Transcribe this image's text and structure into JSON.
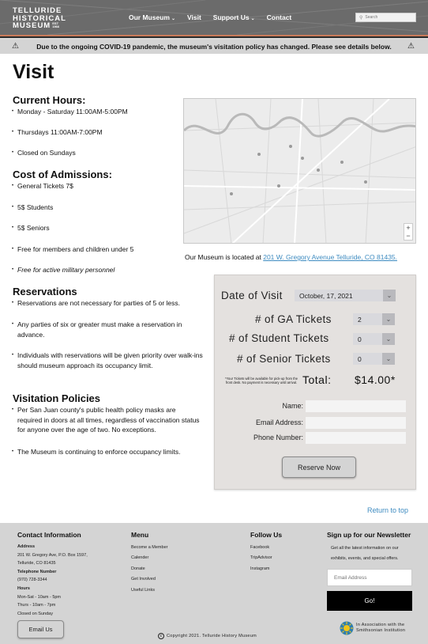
{
  "header": {
    "logo_line1": "TELLURIDE",
    "logo_line2": "HISTORICAL",
    "logo_line3": "MUSEUM",
    "logo_est": "EST 1966",
    "nav": [
      {
        "label": "Our Museum",
        "dropdown": true
      },
      {
        "label": "Visit",
        "dropdown": false
      },
      {
        "label": "Support Us",
        "dropdown": true
      },
      {
        "label": "Contact",
        "dropdown": false
      }
    ],
    "search_placeholder": "Search"
  },
  "alert": {
    "text": "Due to the ongoing COVID-19 pandemic, the museum's visitation policy has changed. Please see details below."
  },
  "page_title": "Visit",
  "hours": {
    "heading": "Current Hours:",
    "items": [
      "Monday - Saturday 11:00AM-5:00PM",
      "Thursdays 11:00AM-7:00PM",
      "Closed on Sundays"
    ]
  },
  "admissions": {
    "heading": "Cost of Admissions:",
    "items": [
      "General Tickets 7$",
      "5$ Students",
      "5$ Seniors",
      "Free for members and children under 5",
      "Free for active military personnel"
    ]
  },
  "reservations": {
    "heading": "Reservations",
    "items": [
      "Reservations are not necessary for parties of 5 or less.",
      "Any parties of six or greater must make a reservation in advance.",
      "Individuals with reservations will be given priority over walk-ins should museum approach its occupancy limit."
    ]
  },
  "policies": {
    "heading": "Visitation Policies",
    "items": [
      "Per San Juan county's public health policy masks are required in doors at all times, regardless of vaccination status for anyone over the age of two. No exceptions.",
      "The Museum is continuing to enforce occupancy limits."
    ]
  },
  "map": {
    "caption_prefix": "Our Museum is located at ",
    "address_link": "201 W. Gregory Avenue Telluride, CO 81435."
  },
  "form": {
    "date_label": "Date of Visit",
    "date_value": "October, 17, 2021",
    "ga_label": "# of GA Tickets",
    "ga_value": "2",
    "student_label": "# of Student Tickets",
    "student_value": "0",
    "senior_label": "# of Senior Tickets",
    "senior_value": "0",
    "note": "*Your Tickets will be available for pick-up from the front desk. No payment is necessary until arrival.",
    "total_label": "Total:",
    "total_value": "$14.00*",
    "name_label": "Name:",
    "email_label": "Email Address:",
    "phone_label": "Phone Number:",
    "reserve_label": "Reserve Now"
  },
  "return_top": "Return to top",
  "footer": {
    "contact_heading": "Contact Information",
    "address_title": "Address",
    "address_line1": "201 W. Gregory Ave, P.O. Box 1597,",
    "address_line2": "Telluride, CO 81435",
    "phone_title": "Telephone Number",
    "phone": "(970) 728-3344",
    "hours_title": "Hours",
    "hours_line1": "Mon-Sat - 10am - 5pm",
    "hours_line2": "Thurs - 10am - 7pm",
    "hours_line3": "Closed on Sunday",
    "email_button": "Email Us",
    "menu_heading": "Menu",
    "menu_items": [
      "Become a Member",
      "Calender",
      "Donate",
      "Get Involved",
      "Useful Links"
    ],
    "follow_heading": "Follow Us",
    "follow_items": [
      "Facebook",
      "TripAdvisor",
      "Instagram"
    ],
    "newsletter_heading": "Sign up for our Newsletter",
    "newsletter_line1": "Get all the latest information on our",
    "newsletter_line2": "exhibits, events, and special offers.",
    "newsletter_placeholder": "Email Address",
    "go_label": "Go!",
    "copyright": "Copyright 2021. Telluride History Museum",
    "smithsonian_line1": "In Association with the",
    "smithsonian_line2": "Smithsonian Institution"
  },
  "colors": {
    "header_bg": "#6b6b6b",
    "accent_stripe": "#c97b5a",
    "alert_bg": "#d4d4d4",
    "link": "#3f8cc1",
    "panel_bg": "#e4e1df",
    "footer_bg": "#d4d4d4"
  }
}
